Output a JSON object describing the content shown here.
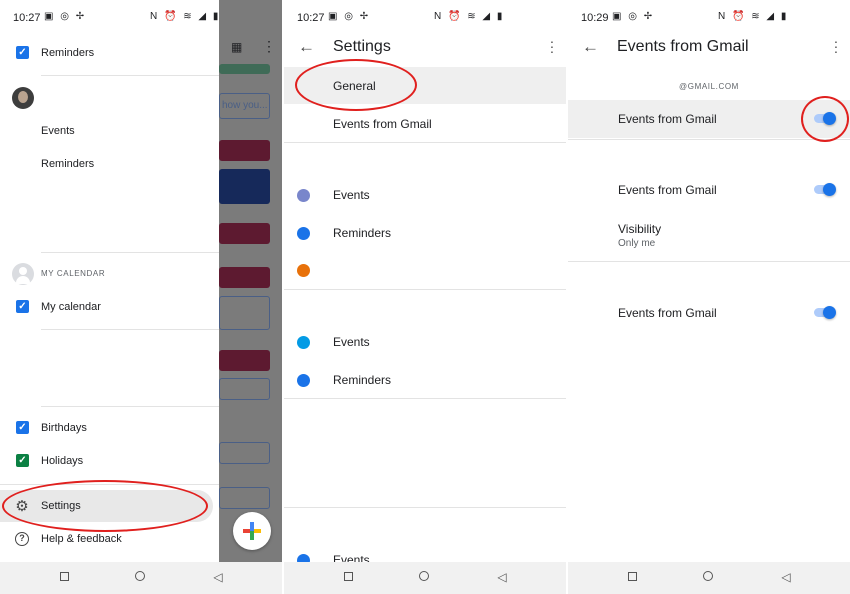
{
  "panels": [
    {
      "status": {
        "time": "10:27",
        "left_icons": "▣ ◎ ✢",
        "right_icons": "N ⏰ ≋ ◢ ▮"
      },
      "drawer": {
        "items_top": [
          {
            "label": "Reminders",
            "checked": true,
            "color": "#1a73e8"
          }
        ],
        "account_items": [
          {
            "label": "Events"
          },
          {
            "label": "Reminders"
          }
        ],
        "section_title": "MY CALENDAR",
        "my_calendar": [
          {
            "label": "My calendar",
            "checked": true,
            "color": "#1a73e8"
          }
        ],
        "others": [
          {
            "label": "Birthdays",
            "checked": true,
            "color": "#1a73e8"
          },
          {
            "label": "Holidays",
            "checked": true,
            "color": "#0b8043"
          }
        ],
        "settings_label": "Settings",
        "help_label": "Help & feedback"
      },
      "behind": {
        "search_hint": "how you..."
      }
    },
    {
      "status": {
        "time": "10:27",
        "left_icons": "▣ ◎ ✢",
        "right_icons": "N ⏰ ≋ ◢ ▮"
      },
      "title": "Settings",
      "items_top": [
        {
          "label": "General"
        },
        {
          "label": "Events from Gmail"
        }
      ],
      "group1": [
        {
          "label": "Events",
          "color": "#7986cb"
        },
        {
          "label": "Reminders",
          "color": "#1a73e8"
        },
        {
          "label": "",
          "color": "#e8710a"
        }
      ],
      "group2": [
        {
          "label": "Events",
          "color": "#039be5"
        },
        {
          "label": "Reminders",
          "color": "#1a73e8"
        }
      ],
      "group3": [
        {
          "label": "Events",
          "color": "#1a73e8"
        }
      ]
    },
    {
      "status": {
        "time": "10:29",
        "left_icons": "▣ ◎ ✢",
        "right_icons": "N ⏰ ≋ ◢ ▮"
      },
      "title": "Events from Gmail",
      "account": "@GMAIL.COM",
      "toggles": [
        {
          "label": "Events from Gmail",
          "on": true
        },
        {
          "label": "Events from Gmail",
          "on": true
        },
        {
          "label": "Events from Gmail",
          "on": true
        }
      ],
      "visibility": {
        "title": "Visibility",
        "value": "Only me"
      }
    }
  ],
  "colors": {
    "annotation": "#e0201e",
    "accent": "#1a73e8"
  }
}
